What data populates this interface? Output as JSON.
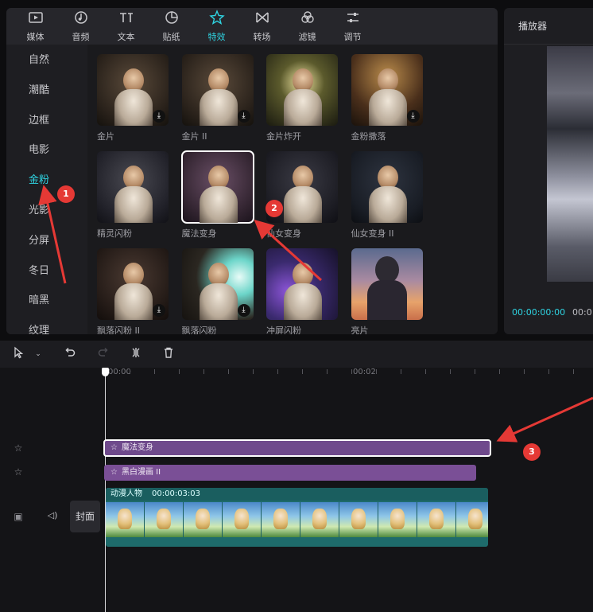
{
  "top_tabs": [
    {
      "label": "媒体",
      "icon": "media-icon"
    },
    {
      "label": "音频",
      "icon": "audio-icon"
    },
    {
      "label": "文本",
      "icon": "text-icon"
    },
    {
      "label": "贴纸",
      "icon": "sticker-icon"
    },
    {
      "label": "特效",
      "icon": "effects-icon",
      "active": true
    },
    {
      "label": "转场",
      "icon": "transition-icon"
    },
    {
      "label": "滤镜",
      "icon": "filter-icon"
    },
    {
      "label": "调节",
      "icon": "adjust-icon"
    }
  ],
  "categories": [
    {
      "label": "自然"
    },
    {
      "label": "潮酷"
    },
    {
      "label": "边框"
    },
    {
      "label": "电影"
    },
    {
      "label": "金粉",
      "active": true
    },
    {
      "label": "光影"
    },
    {
      "label": "分屏"
    },
    {
      "label": "冬日"
    },
    {
      "label": "暗黑"
    },
    {
      "label": "纹理"
    }
  ],
  "effects": [
    {
      "label": "金片",
      "download": true
    },
    {
      "label": "金片 II",
      "download": true
    },
    {
      "label": "金片炸开",
      "download": false
    },
    {
      "label": "金粉撒落",
      "download": true
    },
    {
      "label": "精灵闪粉",
      "download": false
    },
    {
      "label": "魔法变身",
      "download": false,
      "selected": true
    },
    {
      "label": "仙女变身",
      "download": false
    },
    {
      "label": "仙女变身 II",
      "download": false
    },
    {
      "label": "飘落闪粉 II",
      "download": true
    },
    {
      "label": "飘落闪粉",
      "download": true
    },
    {
      "label": "冲屏闪粉",
      "download": false
    },
    {
      "label": "亮片",
      "download": false
    }
  ],
  "player": {
    "title": "播放器",
    "current_time": "00:00:00:00",
    "total_time": "00:0"
  },
  "timeline": {
    "ruler": [
      "00:00",
      "00:02"
    ],
    "tracks": {
      "effect_1": {
        "label": "魔法变身"
      },
      "effect_2": {
        "label": "黑白漫画 II"
      },
      "video": {
        "name": "动漫人物",
        "duration": "00:00:03:03"
      }
    },
    "cover_label": "封面"
  },
  "annotations": [
    "1",
    "2",
    "3"
  ],
  "colors": {
    "accent": "#2fd4e2",
    "effect_clip": "#7a4f96",
    "video_clip": "#1e6b6b",
    "annotation": "#e53935"
  }
}
